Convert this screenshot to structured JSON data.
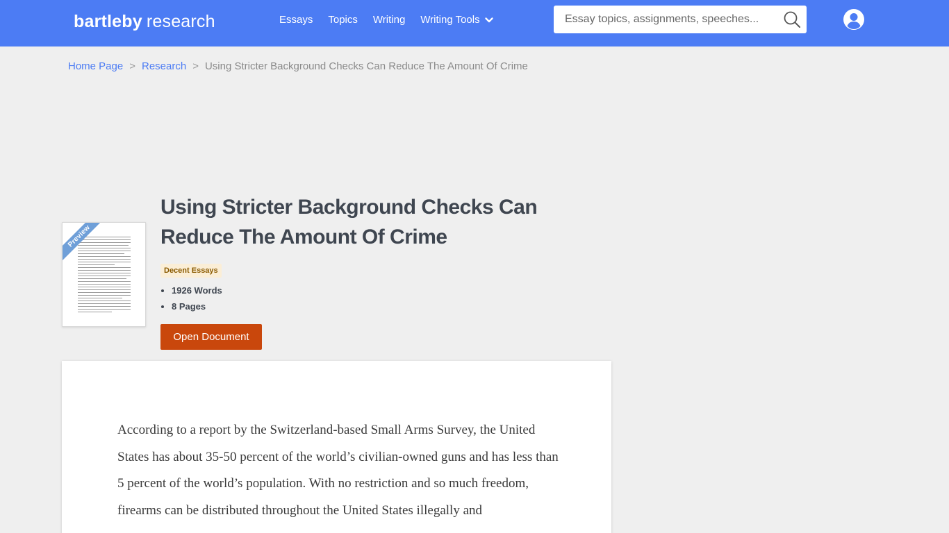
{
  "header": {
    "logo_bold": "bartleby",
    "logo_light": "research",
    "nav": [
      {
        "label": "Essays"
      },
      {
        "label": "Topics"
      },
      {
        "label": "Writing"
      },
      {
        "label": "Writing Tools"
      }
    ],
    "search": {
      "placeholder": "Essay topics, assignments, speeches..."
    },
    "icons": {
      "search": "search-icon",
      "account": "user-account-icon",
      "dropdown": "chevron-down-icon"
    },
    "colors": {
      "bar": "#4c7cf4",
      "accent_button": "#c9470c"
    }
  },
  "breadcrumb": {
    "home": "Home Page",
    "sep": ">",
    "section": "Research",
    "current": "Using Stricter Background Checks Can Reduce The Amount Of Crime"
  },
  "preview": {
    "ribbon": "Preview"
  },
  "document": {
    "title": "Using Stricter Background Checks Can Reduce The Amount Of Crime",
    "badge": "Decent Essays",
    "words": "1926 Words",
    "pages": "8 Pages",
    "open_button": "Open Document",
    "body": "According to a report by the Switzerland-based Small Arms Survey, the United States has about 35-50 percent of the world’s civilian-owned guns and has less than 5 percent of the world’s population. With no restriction and so much freedom, firearms can be distributed throughout the United States illegally and"
  }
}
